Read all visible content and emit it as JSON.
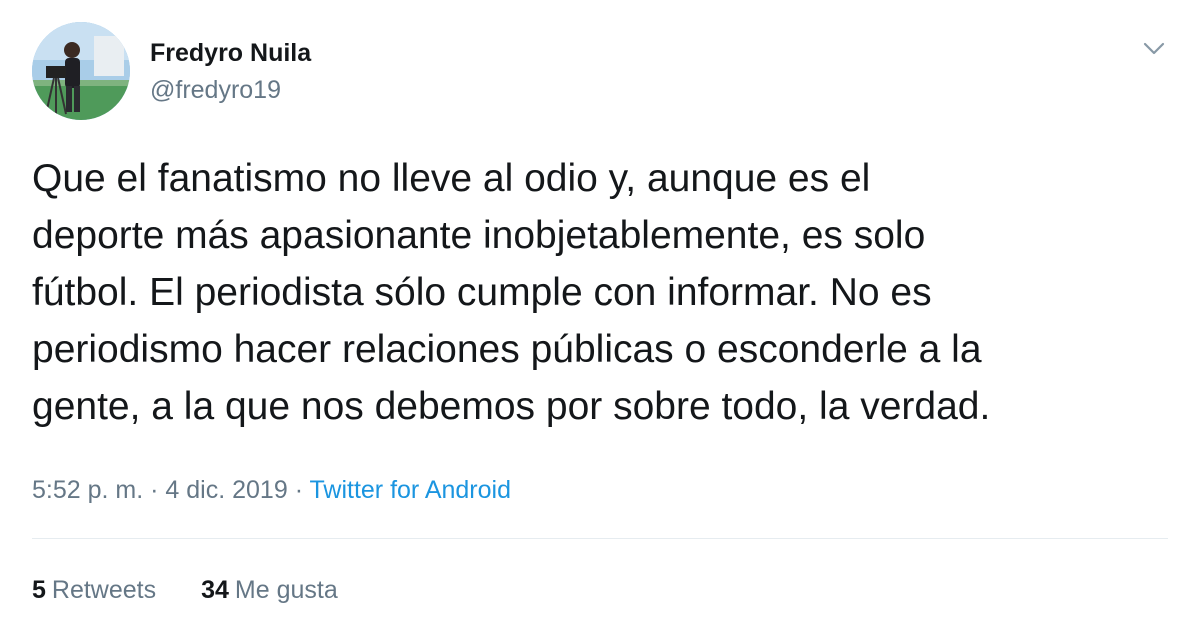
{
  "author": {
    "name": "Fredyro Nuila",
    "handle": "@fredyro19",
    "avatar_icon": "profile-photo"
  },
  "menu_icon": "chevron-down-icon",
  "tweet": {
    "lines": [
      "Que el fanatismo no lleve al odio y, aunque es el",
      "deporte más apasionante inobjetablemente, es solo",
      "fútbol. El periodista sólo cumple con informar. No es",
      "periodismo hacer relaciones públicas o esconderle a la",
      "gente, a la que nos debemos por sobre todo, la verdad."
    ]
  },
  "meta": {
    "time": "5:52 p. m.",
    "separator": "·",
    "date": "4 dic. 2019",
    "source": "Twitter for Android"
  },
  "stats": {
    "retweets_count": "5",
    "retweets_label": "Retweets",
    "likes_count": "34",
    "likes_label": "Me gusta"
  },
  "colors": {
    "text": "#14171a",
    "secondary": "#657786",
    "link": "#1b95e0",
    "divider": "#e6ecf0"
  }
}
